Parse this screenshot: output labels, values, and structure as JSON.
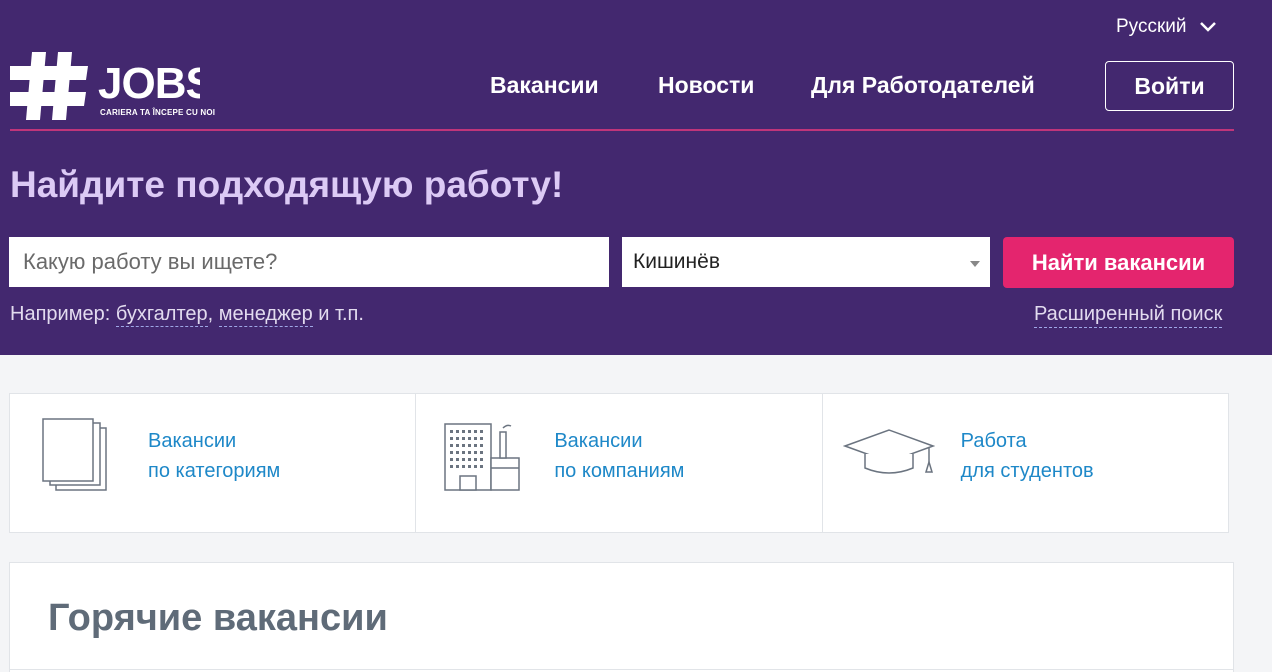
{
  "header": {
    "language": "Русский",
    "logo_text": "#JOBS",
    "logo_tagline": "CARIERA TA ÎNCEPE CU NOI",
    "nav": [
      {
        "label": "Вакансии"
      },
      {
        "label": "Новости"
      },
      {
        "label": "Для Работодателей"
      }
    ],
    "login_label": "Войти"
  },
  "hero": {
    "title": "Найдите подходящую работу!",
    "search_placeholder": "Какую работу вы ищете?",
    "city": "Кишинёв",
    "find_button": "Найти вакансии",
    "example_prefix": "Например:",
    "example_links": [
      "бухгалтер",
      "менеджер"
    ],
    "example_and": "и т.п.",
    "advanced_search": "Расширенный поиск"
  },
  "categories": [
    {
      "line1": "Вакансии",
      "line2": "по категориям",
      "icon": "documents-icon"
    },
    {
      "line1": "Вакансии",
      "line2": "по компаниям",
      "icon": "building-icon"
    },
    {
      "line1": "Работа",
      "line2": "для студентов",
      "icon": "graduation-cap-icon"
    }
  ],
  "hot": {
    "title": "Горячие вакансии"
  },
  "colors": {
    "header_bg": "#43286f",
    "accent": "#e4256e",
    "link": "#1e88c8"
  }
}
